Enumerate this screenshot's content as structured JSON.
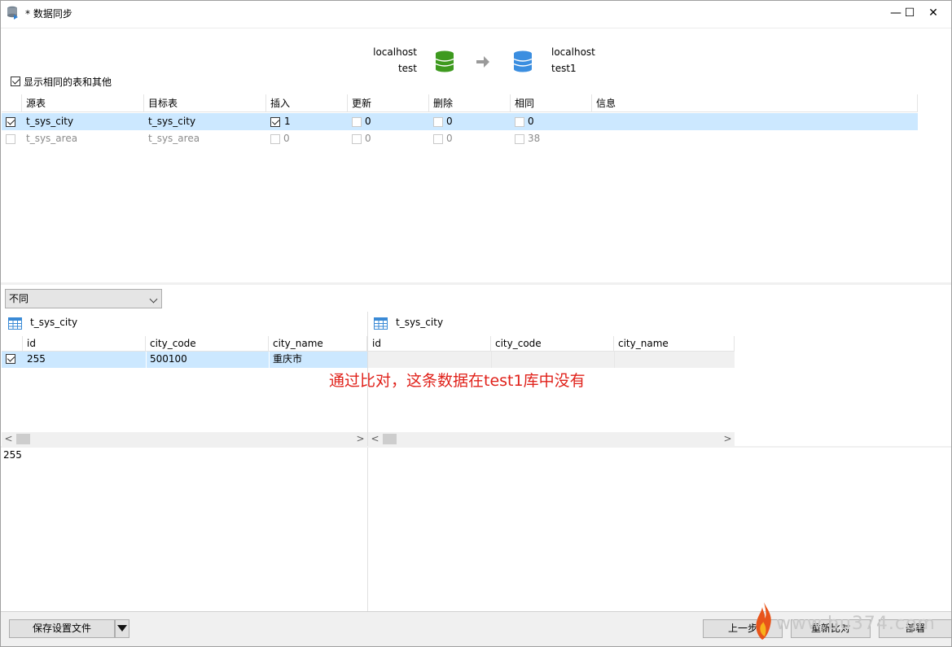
{
  "window": {
    "title": "* 数据同步",
    "minimize": "—",
    "maximize": "☐",
    "close": "✕"
  },
  "connection": {
    "source_host": "localhost",
    "source_db": "test",
    "target_host": "localhost",
    "target_db": "test1",
    "source_color": "#3e9a1f",
    "target_color": "#3b8ee0"
  },
  "options": {
    "show_same_label": "显示相同的表和其他",
    "show_same_checked": true
  },
  "table_list": {
    "columns": [
      "源表",
      "目标表",
      "插入",
      "更新",
      "删除",
      "相同",
      "信息"
    ],
    "rows": [
      {
        "checked": true,
        "source": "t_sys_city",
        "target": "t_sys_city",
        "insert": "1",
        "insert_checked": true,
        "update": "0",
        "delete": "0",
        "same": "0",
        "info": "",
        "selected": true
      },
      {
        "checked": false,
        "source": "t_sys_area",
        "target": "t_sys_area",
        "insert": "0",
        "insert_checked": false,
        "update": "0",
        "delete": "0",
        "same": "38",
        "info": "",
        "selected": false
      }
    ]
  },
  "filter": {
    "value": "不同"
  },
  "left_panel": {
    "table_name": "t_sys_city",
    "columns": [
      "id",
      "city_code",
      "city_name"
    ],
    "rows": [
      {
        "checked": true,
        "id": "255",
        "city_code": "500100",
        "city_name": "重庆市"
      }
    ],
    "detail_value": "255"
  },
  "right_panel": {
    "table_name": "t_sys_city",
    "columns": [
      "id",
      "city_code",
      "city_name"
    ]
  },
  "annotation": "通过比对，这条数据在test1库中没有",
  "buttons": {
    "save_settings": "保存设置文件",
    "prev": "上一步",
    "recompare": "重新比对",
    "deploy": "部署"
  },
  "watermark": "www.bu374.com"
}
